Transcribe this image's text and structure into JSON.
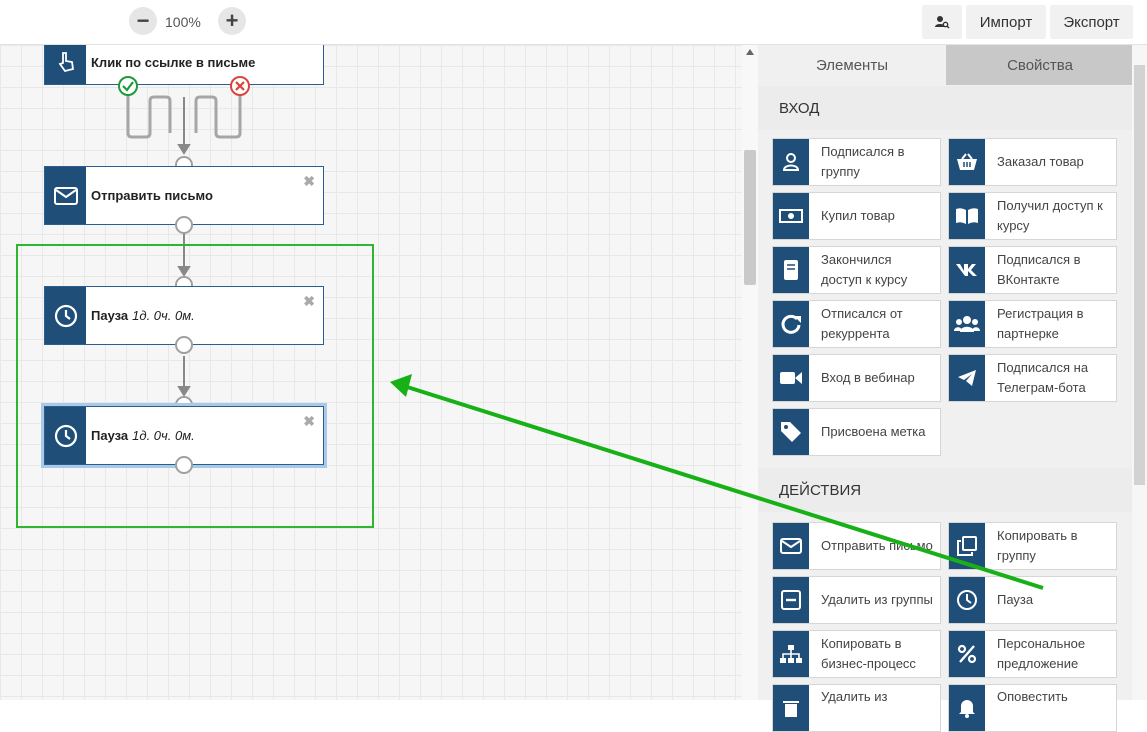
{
  "toolbar": {
    "zoom_out": "−",
    "zoom_level": "100%",
    "zoom_in": "+",
    "import_label": "Импорт",
    "export_label": "Экспорт"
  },
  "canvas": {
    "nodes": [
      {
        "title": "Клик по ссылке в письме",
        "icon": "pointer-hand-icon"
      },
      {
        "title": "Отправить письмо",
        "icon": "envelope-icon"
      },
      {
        "title": "Пауза",
        "detail": "1д. 0ч. 0м.",
        "icon": "clock-icon"
      },
      {
        "title": "Пауза",
        "detail": "1д. 0ч. 0м.",
        "icon": "clock-icon"
      }
    ],
    "close_glyph": "✖",
    "accent_green": "#2fb52f",
    "node_blue": "#1f4e79"
  },
  "panel": {
    "tabs": [
      {
        "label": "Элементы"
      },
      {
        "label": "Свойства"
      }
    ],
    "sections": {
      "entry": {
        "title": "ВХОД",
        "items": [
          {
            "label": "Подписался в группу",
            "icon": "user-icon"
          },
          {
            "label": "Заказал товар",
            "icon": "basket-icon"
          },
          {
            "label": "Купил товар",
            "icon": "banknote-icon"
          },
          {
            "label": "Получил доступ к курсу",
            "icon": "book-open-icon"
          },
          {
            "label": "Закончился доступ к курсу",
            "icon": "book-icon"
          },
          {
            "label": "Подписался в ВКонтакте",
            "icon": "vk-icon"
          },
          {
            "label": "Отписался от рекуррента",
            "icon": "redo-icon"
          },
          {
            "label": "Регистрация в партнерке",
            "icon": "users-icon"
          },
          {
            "label": "Вход в вебинар",
            "icon": "video-camera-icon"
          },
          {
            "label": "Подписался на Телеграм-бота",
            "icon": "telegram-icon"
          },
          {
            "label": "Присвоена метка",
            "icon": "tag-icon"
          }
        ]
      },
      "actions": {
        "title": "ДЕЙСТВИЯ",
        "items": [
          {
            "label": "Отправить письмо",
            "icon": "envelope-icon"
          },
          {
            "label": "Копировать в группу",
            "icon": "copy-icon"
          },
          {
            "label": "Удалить из группы",
            "icon": "minus-square-icon"
          },
          {
            "label": "Пауза",
            "icon": "clock-icon"
          },
          {
            "label": "Копировать в бизнес-процесс",
            "icon": "sitemap-icon"
          },
          {
            "label": "Персональное предложение",
            "icon": "percent-icon"
          },
          {
            "label": "Удалить из",
            "icon": "trash-icon"
          },
          {
            "label": "Оповестить",
            "icon": "bell-icon"
          }
        ]
      }
    }
  }
}
